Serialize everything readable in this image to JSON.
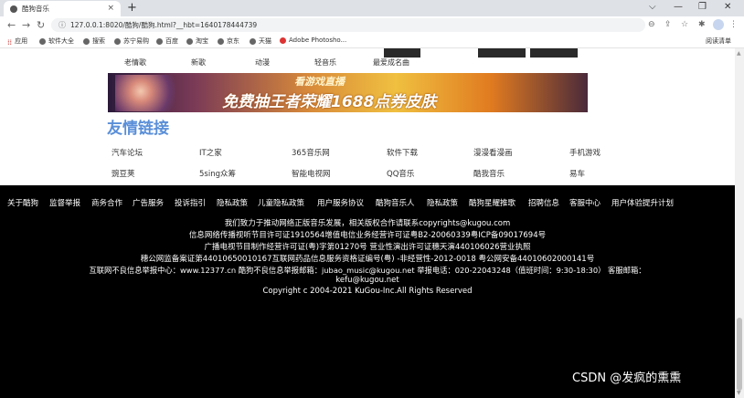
{
  "browser": {
    "tab_title": "酷狗音乐",
    "tab_close": "×",
    "new_tab": "+",
    "window_controls": [
      "⌵",
      "—",
      "❐",
      "✕"
    ],
    "nav": {
      "back": "←",
      "forward": "→",
      "reload": "↻"
    },
    "url": "127.0.0.1:8020/酷狗/酷狗.html?__hbt=1640178444739",
    "omnibox_icons": [
      "⊖",
      "⇪",
      "☆"
    ],
    "toolbar_icons": [
      "✱",
      "▭",
      "⋮"
    ],
    "bookmarks": [
      "应用",
      "软件大全",
      "搜索",
      "苏宁易购",
      "百度",
      "淘宝",
      "京东",
      "天猫",
      "Adobe Photosho..."
    ],
    "reading_list": "阅读清单"
  },
  "categories": [
    "老情歌",
    "新歌",
    "动漫",
    "轻音乐",
    "最爱成名曲"
  ],
  "banner": {
    "line1": "看游戏直播",
    "line2": "免费抽王者荣耀1688点券皮肤"
  },
  "friend_links": {
    "title": "友情链接",
    "row1": [
      "汽车论坛",
      "IT之家",
      "365音乐网",
      "软件下载",
      "漫漫看漫画",
      "手机游戏"
    ],
    "row2": [
      "豌豆荚",
      "5sing众筹",
      "智能电视网",
      "QQ音乐",
      "酷我音乐",
      "易车"
    ]
  },
  "footer": {
    "nav": [
      "关于酷狗",
      "监督举报",
      "商务合作",
      "广告服务",
      "投诉指引",
      "隐私政策",
      "儿童隐私政策",
      "用户服务协议",
      "酷狗音乐人",
      "隐私政策",
      "酷狗星耀推歌",
      "招聘信息",
      "客服中心",
      "用户体验提升计划"
    ],
    "lines": [
      "我们致力于推动网络正版音乐发展，相关版权合作请联系copyrights@kugou.com",
      "信息网络传播视听节目许可证1910564增值电信业务经营许可证粤B2-20060339粤ICP备09017694号",
      "广播电视节目制作经营许可证(粤)字第01270号 营业性演出许可证穗天演440106026营业执照",
      "穗公网监备案证第44010650010167互联网药品信息服务资格证编号(粤) -非经营性-2012-0018 粤公网安备44010602000141号",
      "互联网不良信息举报中心：www.12377.cn 酷狗不良信息举报邮箱：jubao_music@kugou.net 举报电话：020-22043248（值班时间：9:30-18:30） 客服邮箱：",
      "kefu@kugou.net",
      "Copyright c 2004-2021 KuGou-Inc.All Rights Reserved"
    ]
  },
  "watermark": "CSDN @发疯的熏熏"
}
